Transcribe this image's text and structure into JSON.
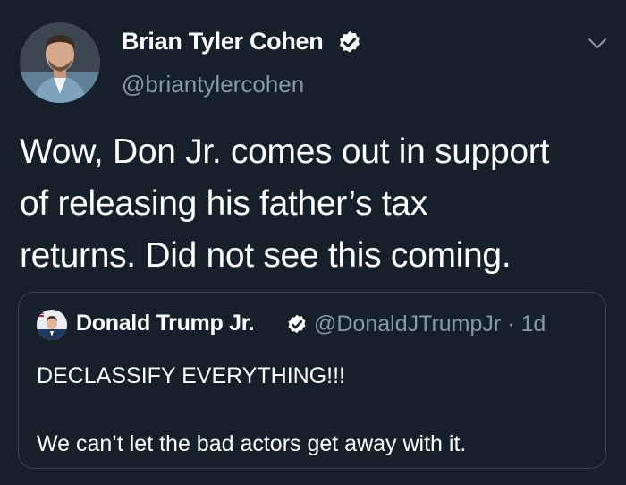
{
  "tweet": {
    "author_name": "Brian Tyler Cohen",
    "author_handle": "@briantylercohen",
    "text_lines": [
      "Wow, Don Jr. comes out in support",
      "of releasing his father’s tax",
      "returns. Did not see this coming."
    ]
  },
  "quoted_tweet": {
    "author_name": "Donald Trump Jr.",
    "author_handle": "@DonaldJTrumpJr",
    "separator": "·",
    "time": "1d",
    "text_lines": [
      "DECLASSIFY EVERYTHING!!!",
      "",
      "We can’t let the bad actors get away with it."
    ]
  },
  "icons": {
    "verified": "verified-badge-icon",
    "menu": "chevron-down-icon"
  },
  "colors": {
    "background": "#15202b",
    "secondary_text": "#8899a6",
    "border": "#38444d"
  }
}
